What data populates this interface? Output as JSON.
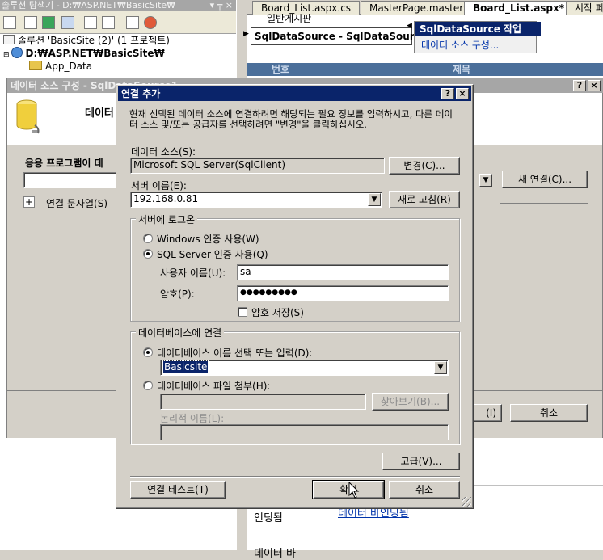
{
  "solution_explorer": {
    "title": "솔루션 탐색기 - D:₩ASP.NET₩BasicSite₩",
    "title_buttons": "▾ ╤ ×",
    "tree": [
      {
        "text": "솔루션 'BasicSite (2)' (1 프로젝트)"
      },
      {
        "text": "D:₩ASP.NET₩BasicSite₩"
      },
      {
        "text": "App_Data"
      }
    ]
  },
  "editor": {
    "tabs": [
      "Board_List.aspx.cs",
      "MasterPage.master",
      "Board_List.aspx*",
      "시작 페"
    ],
    "active_tab": 2,
    "line1": "일반게시판",
    "sqlsource_label": "SqlDataSource - SqlDataSource1",
    "band_col1": "번호",
    "band_col2": "제목",
    "bottom_text1": "인딩됨",
    "bottom_text2": "데이터 바인딩됨",
    "bottom_text3": "데이터 바"
  },
  "smart_tag": {
    "title": "SqlDataSource 작업",
    "link": "데이터 소스 구성..."
  },
  "bg_dialog": {
    "title": "데이터 소스 구성 - SqlDataSource1",
    "header": "데이터",
    "question": "응용 프로그램이 데",
    "new_connection": "새 연결(C)...",
    "connection_string": "연결 문자열(S)",
    "expander": "+",
    "cancel": "취소",
    "hidden_btn": "(I)"
  },
  "dialog": {
    "title": "연결 추가",
    "help_btn": "?",
    "close_btn": "×",
    "intro": "현재 선택된 데이터 소스에 연결하려면 해당되는 필요 정보를 입력하시고, 다른 데이터 소스 및/또는 공급자를 선택하려면 \"변경\"을 클릭하십시오.",
    "data_source_label": "데이터 소스(S):",
    "data_source_value": "Microsoft SQL Server(SqlClient)",
    "change_btn": "변경(C)...",
    "server_name_label": "서버 이름(E):",
    "server_name_value": "192.168.0.81",
    "refresh_btn": "새로 고침(R)",
    "login_group": "서버에 로그온",
    "windows_auth": "Windows 인증 사용(W)",
    "sql_auth": "SQL Server 인증 사용(Q)",
    "auth_selected": "sql",
    "username_label": "사용자 이름(U):",
    "username_value": "sa",
    "password_label": "암호(P):",
    "password_value": "●●●●●●●●●",
    "save_password": "암호 저장(S)",
    "save_password_checked": false,
    "db_group": "데이터베이스에 연결",
    "select_db": "데이터베이스 이름 선택 또는 입력(D):",
    "db_value": "Basicsite",
    "attach_db": "데이터베이스 파일 첨부(H):",
    "browse_btn": "찾아보기(B)...",
    "logical_name": "논리적 이름(L):",
    "advanced_btn": "고급(V)...",
    "test_btn": "연결 테스트(T)",
    "ok_btn": "확인",
    "cancel_btn": "취소"
  },
  "colors": {
    "title_active": "#0a246a",
    "face": "#d4d0c8",
    "selection": "#0a246a",
    "link": "#0033aa"
  }
}
